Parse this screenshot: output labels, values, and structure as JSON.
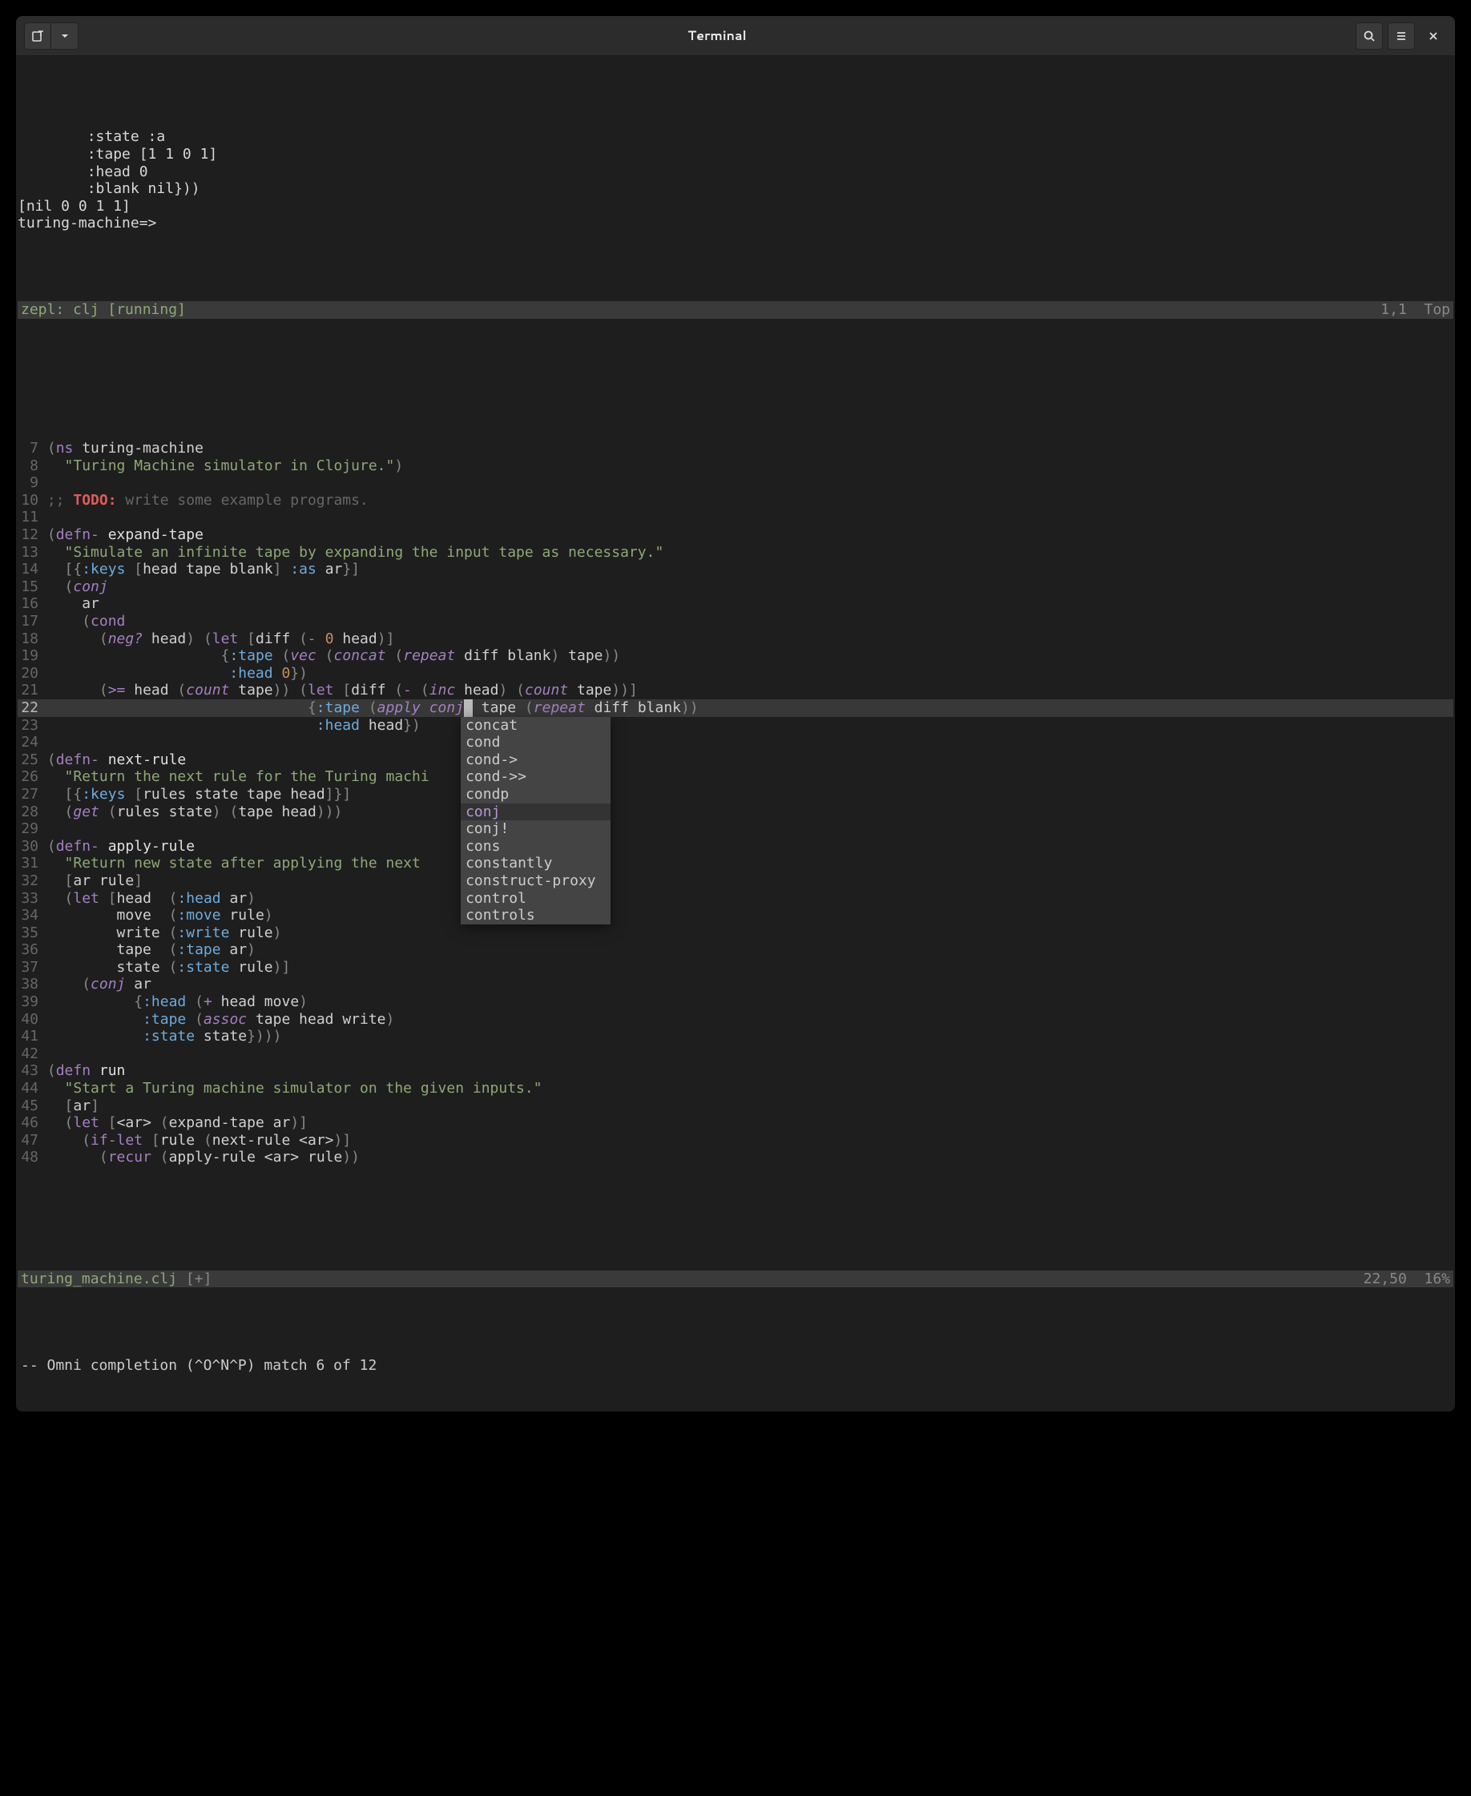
{
  "window": {
    "title": "Terminal"
  },
  "icons": {
    "newtab": "new-tab-icon",
    "dropdown": "chevron-down-icon",
    "search": "search-icon",
    "menu": "hamburger-icon",
    "close": "close-icon"
  },
  "repl": {
    "output_lines": [
      "        :state :a",
      "        :tape [1 1 0 1]",
      "        :head 0",
      "        :blank nil}))",
      "[nil 0 0 1 1]",
      "turing-machine=>"
    ],
    "bar_left": "zepl: clj [running]",
    "bar_pos": "1,1",
    "bar_right": "Top"
  },
  "editor": {
    "first_line_no": 7,
    "current_line_no": 22,
    "lines": [
      {
        "n": 7,
        "segs": [
          {
            "t": "(",
            "c": "paren"
          },
          {
            "t": "ns ",
            "c": "k-def"
          },
          {
            "t": "turing-machine",
            "c": "ns-sym"
          }
        ]
      },
      {
        "n": 8,
        "segs": [
          {
            "t": "  ",
            "c": "sym"
          },
          {
            "t": "\"Turing Machine simulator in Clojure.\"",
            "c": "str"
          },
          {
            "t": ")",
            "c": "paren"
          }
        ]
      },
      {
        "n": 9,
        "segs": []
      },
      {
        "n": 10,
        "segs": [
          {
            "t": ";; ",
            "c": "cmt"
          },
          {
            "t": "TODO:",
            "c": "todo"
          },
          {
            "t": " write some example programs.",
            "c": "cmt"
          }
        ]
      },
      {
        "n": 11,
        "segs": []
      },
      {
        "n": 12,
        "segs": [
          {
            "t": "(",
            "c": "paren"
          },
          {
            "t": "defn- ",
            "c": "k-def"
          },
          {
            "t": "expand-tape",
            "c": "fnname"
          }
        ]
      },
      {
        "n": 13,
        "segs": [
          {
            "t": "  ",
            "c": "sym"
          },
          {
            "t": "\"Simulate an infinite tape by expanding the input tape as necessary.\"",
            "c": "str"
          }
        ]
      },
      {
        "n": 14,
        "segs": [
          {
            "t": "  ",
            "c": "sym"
          },
          {
            "t": "[{",
            "c": "bracket"
          },
          {
            "t": ":keys",
            "c": "kw"
          },
          {
            "t": " [",
            "c": "bracket"
          },
          {
            "t": "head tape blank",
            "c": "sym"
          },
          {
            "t": "] ",
            "c": "bracket"
          },
          {
            "t": ":as",
            "c": "kw"
          },
          {
            "t": " ar",
            "c": "sym"
          },
          {
            "t": "}]",
            "c": "bracket"
          }
        ]
      },
      {
        "n": 15,
        "segs": [
          {
            "t": "  ",
            "c": "sym"
          },
          {
            "t": "(",
            "c": "paren"
          },
          {
            "t": "conj",
            "c": "k-core"
          }
        ]
      },
      {
        "n": 16,
        "segs": [
          {
            "t": "    ar",
            "c": "sym"
          }
        ]
      },
      {
        "n": 17,
        "segs": [
          {
            "t": "    ",
            "c": "sym"
          },
          {
            "t": "(",
            "c": "paren"
          },
          {
            "t": "cond",
            "c": "k-def"
          }
        ]
      },
      {
        "n": 18,
        "segs": [
          {
            "t": "      ",
            "c": "sym"
          },
          {
            "t": "(",
            "c": "paren"
          },
          {
            "t": "neg?",
            "c": "k-core"
          },
          {
            "t": " head",
            "c": "sym"
          },
          {
            "t": ") (",
            "c": "paren"
          },
          {
            "t": "let",
            "c": "k-def"
          },
          {
            "t": " [",
            "c": "bracket"
          },
          {
            "t": "diff ",
            "c": "sym"
          },
          {
            "t": "(",
            "c": "paren"
          },
          {
            "t": "- ",
            "c": "k-core"
          },
          {
            "t": "0",
            "c": "num"
          },
          {
            "t": " head",
            "c": "sym"
          },
          {
            "t": ")]",
            "c": "paren"
          }
        ]
      },
      {
        "n": 19,
        "segs": [
          {
            "t": "                    ",
            "c": "sym"
          },
          {
            "t": "{",
            "c": "brace"
          },
          {
            "t": ":tape",
            "c": "kw"
          },
          {
            "t": " ",
            "c": "sym"
          },
          {
            "t": "(",
            "c": "paren"
          },
          {
            "t": "vec",
            "c": "k-core"
          },
          {
            "t": " ",
            "c": "sym"
          },
          {
            "t": "(",
            "c": "paren"
          },
          {
            "t": "concat",
            "c": "k-core"
          },
          {
            "t": " ",
            "c": "sym"
          },
          {
            "t": "(",
            "c": "paren"
          },
          {
            "t": "repeat",
            "c": "k-core"
          },
          {
            "t": " diff blank",
            "c": "sym"
          },
          {
            "t": ")",
            "c": "paren"
          },
          {
            "t": " tape",
            "c": "sym"
          },
          {
            "t": "))",
            "c": "paren"
          }
        ]
      },
      {
        "n": 20,
        "segs": [
          {
            "t": "                     ",
            "c": "sym"
          },
          {
            "t": ":head",
            "c": "kw"
          },
          {
            "t": " ",
            "c": "sym"
          },
          {
            "t": "0",
            "c": "num"
          },
          {
            "t": "})",
            "c": "brace"
          }
        ]
      },
      {
        "n": 21,
        "segs": [
          {
            "t": "      ",
            "c": "sym"
          },
          {
            "t": "(",
            "c": "paren"
          },
          {
            "t": ">= ",
            "c": "k-core"
          },
          {
            "t": "head ",
            "c": "sym"
          },
          {
            "t": "(",
            "c": "paren"
          },
          {
            "t": "count",
            "c": "k-core"
          },
          {
            "t": " tape",
            "c": "sym"
          },
          {
            "t": ")) (",
            "c": "paren"
          },
          {
            "t": "let",
            "c": "k-def"
          },
          {
            "t": " [",
            "c": "bracket"
          },
          {
            "t": "diff ",
            "c": "sym"
          },
          {
            "t": "(",
            "c": "paren"
          },
          {
            "t": "- ",
            "c": "k-core"
          },
          {
            "t": "(",
            "c": "paren"
          },
          {
            "t": "inc",
            "c": "k-core"
          },
          {
            "t": " head",
            "c": "sym"
          },
          {
            "t": ") (",
            "c": "paren"
          },
          {
            "t": "count",
            "c": "k-core"
          },
          {
            "t": " tape",
            "c": "sym"
          },
          {
            "t": "))]",
            "c": "paren"
          }
        ]
      },
      {
        "n": 22,
        "segs": [
          {
            "t": "                              ",
            "c": "sym"
          },
          {
            "t": "{",
            "c": "brace"
          },
          {
            "t": ":tape",
            "c": "kw"
          },
          {
            "t": " ",
            "c": "sym"
          },
          {
            "t": "(",
            "c": "paren"
          },
          {
            "t": "apply",
            "c": "k-core"
          },
          {
            "t": " ",
            "c": "sym"
          },
          {
            "t": "conj",
            "c": "k-core"
          },
          {
            "t": "",
            "c": "cursor"
          },
          {
            "t": " tape ",
            "c": "sym"
          },
          {
            "t": "(",
            "c": "paren"
          },
          {
            "t": "repeat",
            "c": "k-core"
          },
          {
            "t": " diff blank",
            "c": "sym"
          },
          {
            "t": "))",
            "c": "paren"
          }
        ]
      },
      {
        "n": 23,
        "segs": [
          {
            "t": "                               ",
            "c": "sym"
          },
          {
            "t": ":head",
            "c": "kw"
          },
          {
            "t": " head",
            "c": "sym"
          },
          {
            "t": "})",
            "c": "brace"
          }
        ]
      },
      {
        "n": 24,
        "segs": []
      },
      {
        "n": 25,
        "segs": [
          {
            "t": "(",
            "c": "paren"
          },
          {
            "t": "defn- ",
            "c": "k-def"
          },
          {
            "t": "next-rule",
            "c": "fnname"
          }
        ]
      },
      {
        "n": 26,
        "segs": [
          {
            "t": "  ",
            "c": "sym"
          },
          {
            "t": "\"Return the next rule for the Turing machi",
            "c": "str"
          }
        ]
      },
      {
        "n": 27,
        "segs": [
          {
            "t": "  ",
            "c": "sym"
          },
          {
            "t": "[{",
            "c": "bracket"
          },
          {
            "t": ":keys",
            "c": "kw"
          },
          {
            "t": " [",
            "c": "bracket"
          },
          {
            "t": "rules state tape head",
            "c": "sym"
          },
          {
            "t": "]}]",
            "c": "bracket"
          }
        ]
      },
      {
        "n": 28,
        "segs": [
          {
            "t": "  ",
            "c": "sym"
          },
          {
            "t": "(",
            "c": "paren"
          },
          {
            "t": "get",
            "c": "k-core"
          },
          {
            "t": " ",
            "c": "sym"
          },
          {
            "t": "(",
            "c": "paren"
          },
          {
            "t": "rules state",
            "c": "sym"
          },
          {
            "t": ") (",
            "c": "paren"
          },
          {
            "t": "tape head",
            "c": "sym"
          },
          {
            "t": ")))",
            "c": "paren"
          }
        ]
      },
      {
        "n": 29,
        "segs": []
      },
      {
        "n": 30,
        "segs": [
          {
            "t": "(",
            "c": "paren"
          },
          {
            "t": "defn- ",
            "c": "k-def"
          },
          {
            "t": "apply-rule",
            "c": "fnname"
          }
        ]
      },
      {
        "n": 31,
        "segs": [
          {
            "t": "  ",
            "c": "sym"
          },
          {
            "t": "\"Return new state after applying the next ",
            "c": "str"
          }
        ]
      },
      {
        "n": 32,
        "segs": [
          {
            "t": "  ",
            "c": "sym"
          },
          {
            "t": "[",
            "c": "bracket"
          },
          {
            "t": "ar rule",
            "c": "sym"
          },
          {
            "t": "]",
            "c": "bracket"
          }
        ]
      },
      {
        "n": 33,
        "segs": [
          {
            "t": "  ",
            "c": "sym"
          },
          {
            "t": "(",
            "c": "paren"
          },
          {
            "t": "let",
            "c": "k-def"
          },
          {
            "t": " [",
            "c": "bracket"
          },
          {
            "t": "head  ",
            "c": "sym"
          },
          {
            "t": "(",
            "c": "paren"
          },
          {
            "t": ":head",
            "c": "kw"
          },
          {
            "t": " ar",
            "c": "sym"
          },
          {
            "t": ")",
            "c": "paren"
          }
        ]
      },
      {
        "n": 34,
        "segs": [
          {
            "t": "        move  ",
            "c": "sym"
          },
          {
            "t": "(",
            "c": "paren"
          },
          {
            "t": ":move",
            "c": "kw"
          },
          {
            "t": " rule",
            "c": "sym"
          },
          {
            "t": ")",
            "c": "paren"
          }
        ]
      },
      {
        "n": 35,
        "segs": [
          {
            "t": "        write ",
            "c": "sym"
          },
          {
            "t": "(",
            "c": "paren"
          },
          {
            "t": ":write",
            "c": "kw"
          },
          {
            "t": " rule",
            "c": "sym"
          },
          {
            "t": ")",
            "c": "paren"
          }
        ]
      },
      {
        "n": 36,
        "segs": [
          {
            "t": "        tape  ",
            "c": "sym"
          },
          {
            "t": "(",
            "c": "paren"
          },
          {
            "t": ":tape",
            "c": "kw"
          },
          {
            "t": " ar",
            "c": "sym"
          },
          {
            "t": ")",
            "c": "paren"
          }
        ]
      },
      {
        "n": 37,
        "segs": [
          {
            "t": "        state ",
            "c": "sym"
          },
          {
            "t": "(",
            "c": "paren"
          },
          {
            "t": ":state",
            "c": "kw"
          },
          {
            "t": " rule",
            "c": "sym"
          },
          {
            "t": ")]",
            "c": "paren"
          }
        ]
      },
      {
        "n": 38,
        "segs": [
          {
            "t": "    ",
            "c": "sym"
          },
          {
            "t": "(",
            "c": "paren"
          },
          {
            "t": "conj",
            "c": "k-core"
          },
          {
            "t": " ar",
            "c": "sym"
          }
        ]
      },
      {
        "n": 39,
        "segs": [
          {
            "t": "          ",
            "c": "sym"
          },
          {
            "t": "{",
            "c": "brace"
          },
          {
            "t": ":head",
            "c": "kw"
          },
          {
            "t": " ",
            "c": "sym"
          },
          {
            "t": "(",
            "c": "paren"
          },
          {
            "t": "+",
            "c": "k-core"
          },
          {
            "t": " head move",
            "c": "sym"
          },
          {
            "t": ")",
            "c": "paren"
          }
        ]
      },
      {
        "n": 40,
        "segs": [
          {
            "t": "           ",
            "c": "sym"
          },
          {
            "t": ":tape",
            "c": "kw"
          },
          {
            "t": " ",
            "c": "sym"
          },
          {
            "t": "(",
            "c": "paren"
          },
          {
            "t": "assoc",
            "c": "k-core"
          },
          {
            "t": " tape head write",
            "c": "sym"
          },
          {
            "t": ")",
            "c": "paren"
          }
        ]
      },
      {
        "n": 41,
        "segs": [
          {
            "t": "           ",
            "c": "sym"
          },
          {
            "t": ":state",
            "c": "kw"
          },
          {
            "t": " state",
            "c": "sym"
          },
          {
            "t": "})))",
            "c": "brace"
          }
        ]
      },
      {
        "n": 42,
        "segs": []
      },
      {
        "n": 43,
        "segs": [
          {
            "t": "(",
            "c": "paren"
          },
          {
            "t": "defn ",
            "c": "k-def"
          },
          {
            "t": "run",
            "c": "fnname"
          }
        ]
      },
      {
        "n": 44,
        "segs": [
          {
            "t": "  ",
            "c": "sym"
          },
          {
            "t": "\"Start a Turing machine simulator on the given inputs.\"",
            "c": "str"
          }
        ]
      },
      {
        "n": 45,
        "segs": [
          {
            "t": "  ",
            "c": "sym"
          },
          {
            "t": "[",
            "c": "bracket"
          },
          {
            "t": "ar",
            "c": "sym"
          },
          {
            "t": "]",
            "c": "bracket"
          }
        ]
      },
      {
        "n": 46,
        "segs": [
          {
            "t": "  ",
            "c": "sym"
          },
          {
            "t": "(",
            "c": "paren"
          },
          {
            "t": "let",
            "c": "k-def"
          },
          {
            "t": " [",
            "c": "bracket"
          },
          {
            "t": "<ar> ",
            "c": "sym"
          },
          {
            "t": "(",
            "c": "paren"
          },
          {
            "t": "expand-tape ar",
            "c": "sym"
          },
          {
            "t": ")]",
            "c": "paren"
          }
        ]
      },
      {
        "n": 47,
        "segs": [
          {
            "t": "    ",
            "c": "sym"
          },
          {
            "t": "(",
            "c": "paren"
          },
          {
            "t": "if-let",
            "c": "k-def"
          },
          {
            "t": " [",
            "c": "bracket"
          },
          {
            "t": "rule ",
            "c": "sym"
          },
          {
            "t": "(",
            "c": "paren"
          },
          {
            "t": "next-rule <ar>",
            "c": "sym"
          },
          {
            "t": ")]",
            "c": "paren"
          }
        ]
      },
      {
        "n": 48,
        "segs": [
          {
            "t": "      ",
            "c": "sym"
          },
          {
            "t": "(",
            "c": "paren"
          },
          {
            "t": "recur",
            "c": "k-def"
          },
          {
            "t": " ",
            "c": "sym"
          },
          {
            "t": "(",
            "c": "paren"
          },
          {
            "t": "apply-rule <ar> rule",
            "c": "sym"
          },
          {
            "t": "))",
            "c": "paren"
          }
        ]
      }
    ]
  },
  "completion_popup": {
    "items": [
      "concat",
      "cond",
      "cond->",
      "cond->>",
      "condp",
      "conj",
      "conj!",
      "cons",
      "constantly",
      "construct-proxy",
      "control",
      "controls"
    ],
    "selected_index": 5
  },
  "statusbar": {
    "filename": "turing_machine.clj",
    "modified": "[+]",
    "pos": "22,50",
    "pct": "16%"
  },
  "cmdline": "-- Omni completion (^O^N^P) match 6 of 12"
}
